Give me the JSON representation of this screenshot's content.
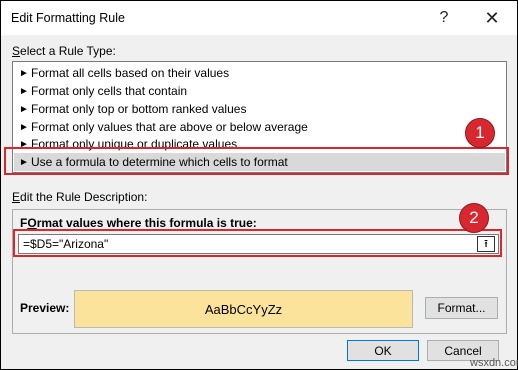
{
  "dialog": {
    "title": "Edit Formatting Rule",
    "help_glyph": "?",
    "close_glyph": "✕"
  },
  "rule_type": {
    "label_accel": "S",
    "label_rest": "elect a Rule Type:",
    "items": [
      {
        "label": "Format all cells based on their values",
        "selected": false
      },
      {
        "label": "Format only cells that contain",
        "selected": false
      },
      {
        "label": "Format only top or bottom ranked values",
        "selected": false
      },
      {
        "label": "Format only values that are above or below average",
        "selected": false
      },
      {
        "label": "Format only unique or duplicate values",
        "selected": false
      },
      {
        "label": "Use a formula to determine which cells to format",
        "selected": true
      }
    ]
  },
  "description": {
    "label_accel": "E",
    "label_rest": "dit the Rule Description:",
    "formula_label_accel": "O",
    "formula_label_pre": "F",
    "formula_label_rest": "rmat values where this formula is true:",
    "formula_value": "=$D5=\"Arizona\"",
    "collapse_glyph": "⭱"
  },
  "preview": {
    "label": "Preview:",
    "sample_text": "AaBbCcYyZz",
    "fill_color": "#fce39b"
  },
  "buttons": {
    "format_label": "Format...",
    "ok_label": "OK",
    "cancel_label": "Cancel"
  },
  "callouts": {
    "color": "#d7282f",
    "first": "1",
    "second": "2"
  },
  "watermark": "wsxdn.com"
}
